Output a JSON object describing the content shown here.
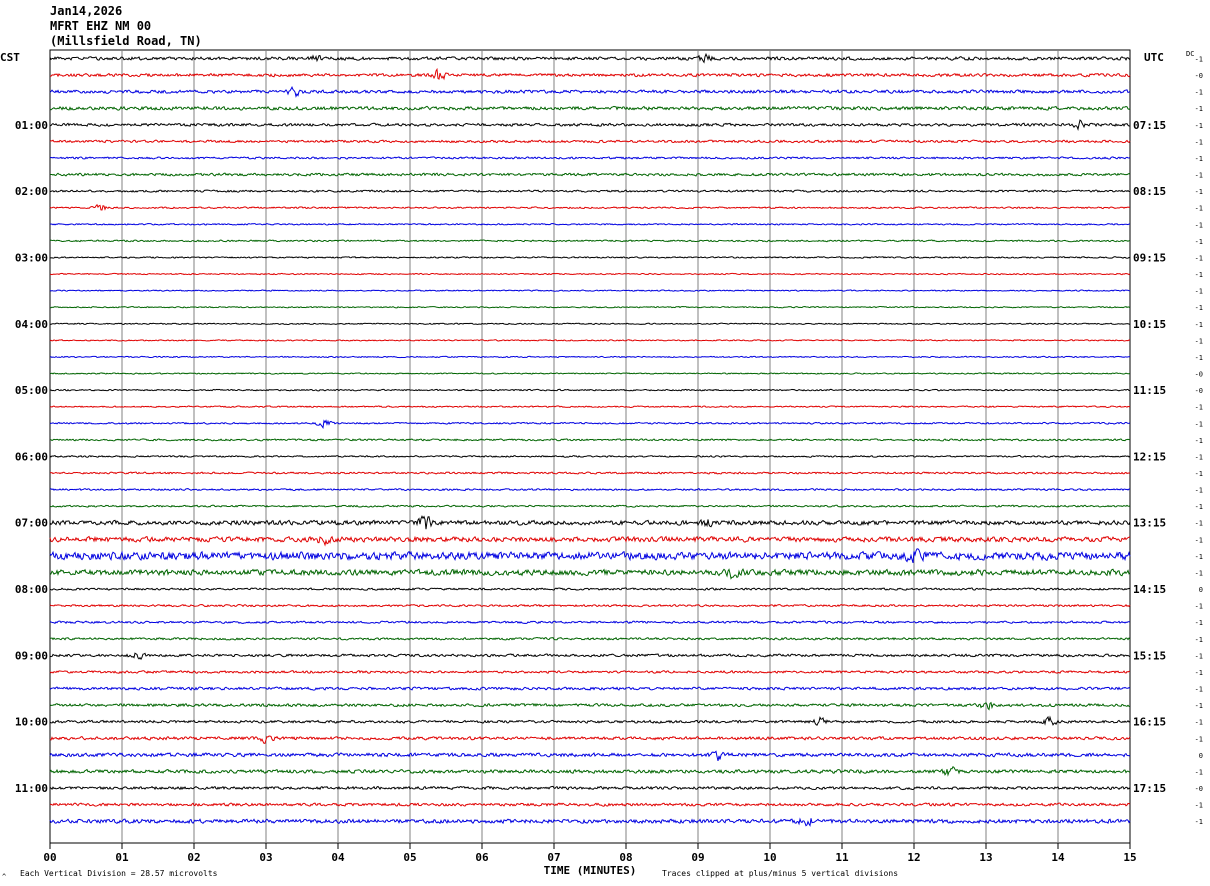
{
  "header": {
    "date": "Jan14,2026",
    "station": "MFRT EHZ NM 00",
    "location": "(Millsfield Road, TN)"
  },
  "left_tz": "CST",
  "right_tz": "UTC",
  "dc_label": "DC",
  "footer": {
    "division": "Each Vertical Division =   28.57 microvolts",
    "xlabel": "TIME (MINUTES)",
    "clip_note": "Traces clipped at plus/minus 5 vertical divisions",
    "corner_mark": "^"
  },
  "colors": {
    "black": "#000000",
    "red": "#e00000",
    "blue": "#0000e0",
    "green": "#006400",
    "grid": "#808080"
  },
  "chart_data": {
    "type": "line",
    "title": "MFRT EHZ NM 00 (Millsfield Road, TN) Jan14,2026",
    "xlabel": "TIME (MINUTES)",
    "x_range": [
      0,
      15
    ],
    "x_ticks": [
      "00",
      "01",
      "02",
      "03",
      "04",
      "05",
      "06",
      "07",
      "08",
      "09",
      "10",
      "11",
      "12",
      "13",
      "14",
      "15"
    ],
    "trace_minutes": 15,
    "trace_count": 47,
    "trace_color_cycle": [
      "black",
      "red",
      "blue",
      "green"
    ],
    "left_hour_labels": [
      "01:00",
      "02:00",
      "03:00",
      "04:00",
      "05:00",
      "06:00",
      "07:00",
      "08:00",
      "09:00",
      "10:00",
      "11:00"
    ],
    "right_hour_labels": [
      "07:15",
      "08:15",
      "09:15",
      "10:15",
      "11:15",
      "12:15",
      "13:15",
      "14:15",
      "15:15",
      "16:15",
      "17:15"
    ],
    "hour_label_trace_indices": [
      4,
      8,
      12,
      16,
      20,
      24,
      28,
      32,
      36,
      40,
      44
    ],
    "dc_offsets": [
      "-1",
      "-0",
      "-1",
      "-1",
      "-1",
      "-1",
      "-1",
      "-1",
      "-1",
      "-1",
      "-1",
      "-1",
      "-1",
      "-1",
      "-1",
      "-1",
      "-1",
      "-1",
      "-1",
      "-0",
      "-0",
      "-1",
      "-1",
      "-1",
      "-1",
      "-1",
      "-1",
      "-1",
      "-1",
      "-1",
      "-1",
      "-1",
      "0",
      "-1",
      "-1",
      "-1",
      "-1",
      "-1",
      "-1",
      "-1",
      "-1",
      "-1",
      "0",
      "-1",
      "-0",
      "-1",
      "-1",
      "-1",
      "-1",
      "-1"
    ],
    "noise_levels": [
      1.6,
      1.5,
      1.6,
      1.7,
      1.4,
      1.2,
      1.0,
      1.3,
      1.0,
      0.8,
      0.7,
      0.8,
      0.7,
      0.6,
      0.6,
      0.6,
      0.6,
      0.6,
      0.6,
      0.6,
      0.7,
      0.7,
      0.8,
      0.9,
      0.8,
      0.9,
      0.9,
      0.9,
      2.2,
      2.5,
      3.8,
      2.8,
      1.0,
      1.0,
      1.1,
      1.1,
      1.3,
      1.2,
      1.4,
      1.4,
      1.3,
      1.5,
      1.8,
      1.7,
      1.4,
      1.4,
      2.0,
      1.6
    ],
    "events": [
      {
        "trace": 0,
        "minute": 3.7,
        "amp": 3
      },
      {
        "trace": 0,
        "minute": 9.1,
        "amp": 3
      },
      {
        "trace": 1,
        "minute": 5.4,
        "amp": 5
      },
      {
        "trace": 2,
        "minute": 3.4,
        "amp": 4
      },
      {
        "trace": 4,
        "minute": 14.3,
        "amp": 4
      },
      {
        "trace": 9,
        "minute": 0.7,
        "amp": 3
      },
      {
        "trace": 22,
        "minute": 3.8,
        "amp": 4
      },
      {
        "trace": 28,
        "minute": 5.2,
        "amp": 7
      },
      {
        "trace": 28,
        "minute": 9.1,
        "amp": 4
      },
      {
        "trace": 29,
        "minute": 3.8,
        "amp": 4
      },
      {
        "trace": 30,
        "minute": 12.0,
        "amp": 7
      },
      {
        "trace": 31,
        "minute": 9.5,
        "amp": 6
      },
      {
        "trace": 36,
        "minute": 1.2,
        "amp": 5
      },
      {
        "trace": 39,
        "minute": 13.0,
        "amp": 5
      },
      {
        "trace": 40,
        "minute": 10.7,
        "amp": 4
      },
      {
        "trace": 40,
        "minute": 13.9,
        "amp": 4
      },
      {
        "trace": 41,
        "minute": 3.0,
        "amp": 4
      },
      {
        "trace": 42,
        "minute": 9.3,
        "amp": 5
      },
      {
        "trace": 43,
        "minute": 12.5,
        "amp": 5
      },
      {
        "trace": 46,
        "minute": 10.5,
        "amp": 5
      }
    ]
  }
}
